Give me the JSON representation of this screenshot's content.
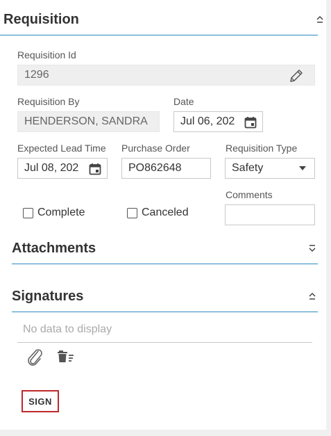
{
  "requisition": {
    "title": "Requisition",
    "fields": {
      "requisition_id_label": "Requisition Id",
      "requisition_id_value": "1296",
      "requisition_by_label": "Requisition By",
      "requisition_by_value": "HENDERSON, SANDRA",
      "date_label": "Date",
      "date_value": "Jul 06, 202",
      "expected_lead_time_label": "Expected Lead Time",
      "expected_lead_time_value": "Jul 08, 202",
      "purchase_order_label": "Purchase Order",
      "purchase_order_value": "PO862648",
      "requisition_type_label": "Requisition Type",
      "requisition_type_value": "Safety",
      "comments_label": "Comments",
      "comments_value": ""
    },
    "checkboxes": {
      "complete_label": "Complete",
      "canceled_label": "Canceled"
    }
  },
  "attachments": {
    "title": "Attachments"
  },
  "signatures": {
    "title": "Signatures",
    "empty_text": "No data to display",
    "sign_label": "SIGN"
  },
  "colors": {
    "accent": "#2a8ac2",
    "sign_border": "#c0282a"
  }
}
